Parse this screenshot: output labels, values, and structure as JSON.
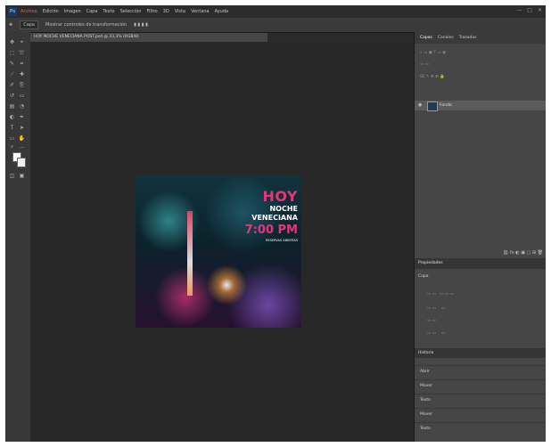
{
  "app": {
    "logo": "Ps"
  },
  "menu": [
    "Archivo",
    "Edición",
    "Imagen",
    "Capa",
    "Texto",
    "Selección",
    "Filtro",
    "3D",
    "Vista",
    "Ventana",
    "Ayuda"
  ],
  "window_controls": [
    "—",
    "□",
    "✕"
  ],
  "options_bar": {
    "items": [
      "Capa",
      "Mostrar controles de transformación"
    ]
  },
  "document": {
    "tab_title": "HOY NOCHE VENECIANA POST.psd @ 33,3% (RGB/8)"
  },
  "poster": {
    "hoy": "HOY",
    "noche": "NOCHE",
    "veneciana": "VENECIANA",
    "time": "7:00 PM",
    "sub": "RESERVAS ABIERTAS"
  },
  "panels": {
    "tabs": [
      "Capas",
      "Canales",
      "Trazados"
    ],
    "layer_name": "Fondo",
    "properties_header": "Propiedades",
    "properties_sub": "Capa",
    "history_header": "Historia",
    "history_items": [
      "Abrir",
      "Mover",
      "Texto",
      "Mover",
      "Texto"
    ]
  },
  "colors": {
    "accent": "#e8357a",
    "workspace": "#282828"
  }
}
